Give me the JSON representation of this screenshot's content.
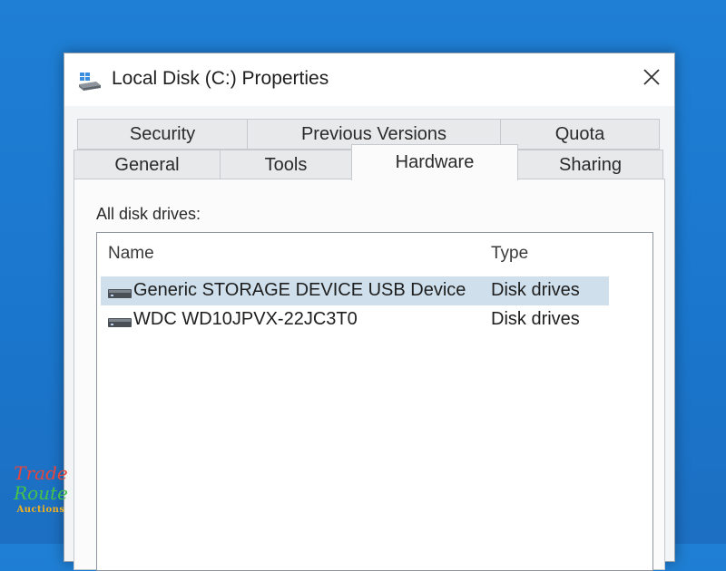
{
  "window": {
    "title": "Local Disk (C:) Properties",
    "close_icon": "close-icon"
  },
  "tabs": {
    "row_back": [
      {
        "label": "Security"
      },
      {
        "label": "Previous Versions"
      },
      {
        "label": "Quota"
      }
    ],
    "row_front": [
      {
        "label": "General"
      },
      {
        "label": "Tools"
      },
      {
        "label": "Hardware",
        "active": true
      },
      {
        "label": "Sharing"
      }
    ]
  },
  "hardware": {
    "group_label": "All disk drives:",
    "columns": [
      "Name",
      "Type"
    ],
    "rows": [
      {
        "name": "Generic STORAGE DEVICE USB Device",
        "type": "Disk drives",
        "selected": true
      },
      {
        "name": "WDC WD10JPVX-22JC3T0",
        "type": "Disk drives",
        "selected": false
      }
    ]
  },
  "watermark": {
    "line1": "Trade",
    "line2": "Route",
    "line3": "Auctions"
  },
  "colors": {
    "desktop": "#1f7fd4",
    "selection": "#cfe0ec"
  }
}
